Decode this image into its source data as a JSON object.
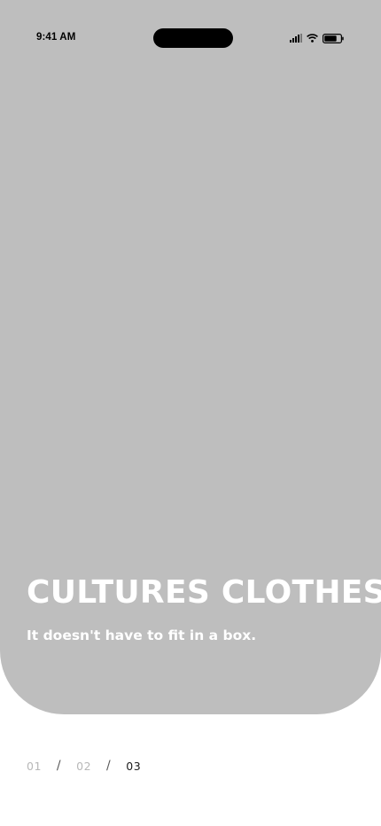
{
  "status_bar": {
    "time": "9:41 AM",
    "icons": [
      "cellular-signal-icon",
      "wifi-icon",
      "battery-icon"
    ]
  },
  "hero": {
    "background_color": "#bebebe",
    "title": "CULTURES CLOTHES",
    "subtitle": "It doesn't have to fit in a box."
  },
  "pager": {
    "separator": "/",
    "pages": [
      {
        "label": "01",
        "active": false
      },
      {
        "label": "02",
        "active": false
      },
      {
        "label": "03",
        "active": true
      }
    ]
  }
}
